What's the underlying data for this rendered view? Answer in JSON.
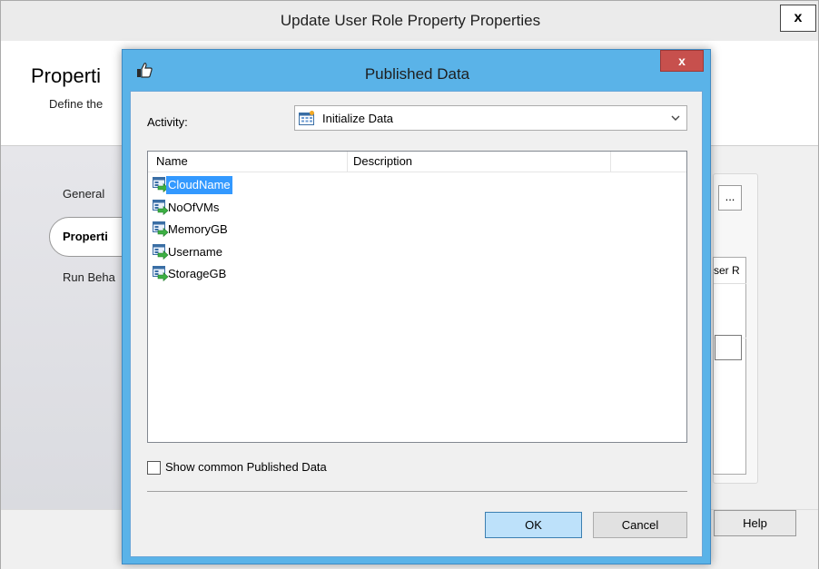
{
  "background_window": {
    "title": "Update User Role Property Properties",
    "close_label": "x",
    "heading": "Properti",
    "subheading": "Define the",
    "nav": [
      "General",
      "Properti",
      "Run Beha"
    ],
    "ellipsis_label": "...",
    "column_fragment": "ser R",
    "help_label": "Help"
  },
  "dialog": {
    "title": "Published Data",
    "close_label": "x",
    "activity_label": "Activity:",
    "activity_value": "Initialize Data",
    "columns": [
      "Name",
      "Description"
    ],
    "items": [
      "CloudName",
      "NoOfVMs",
      "MemoryGB",
      "Username",
      "StorageGB"
    ],
    "selected_item": "CloudName",
    "checkbox_label": "Show common Published Data",
    "checkbox_checked": false,
    "ok_label": "OK",
    "cancel_label": "Cancel",
    "colors": {
      "frame": "#5ab3e8",
      "close": "#c7504d",
      "selection": "#3399ff"
    },
    "icons": {
      "title": "thumbs-up-icon",
      "activity": "calendar-icon",
      "item": "data-variable-icon"
    }
  }
}
